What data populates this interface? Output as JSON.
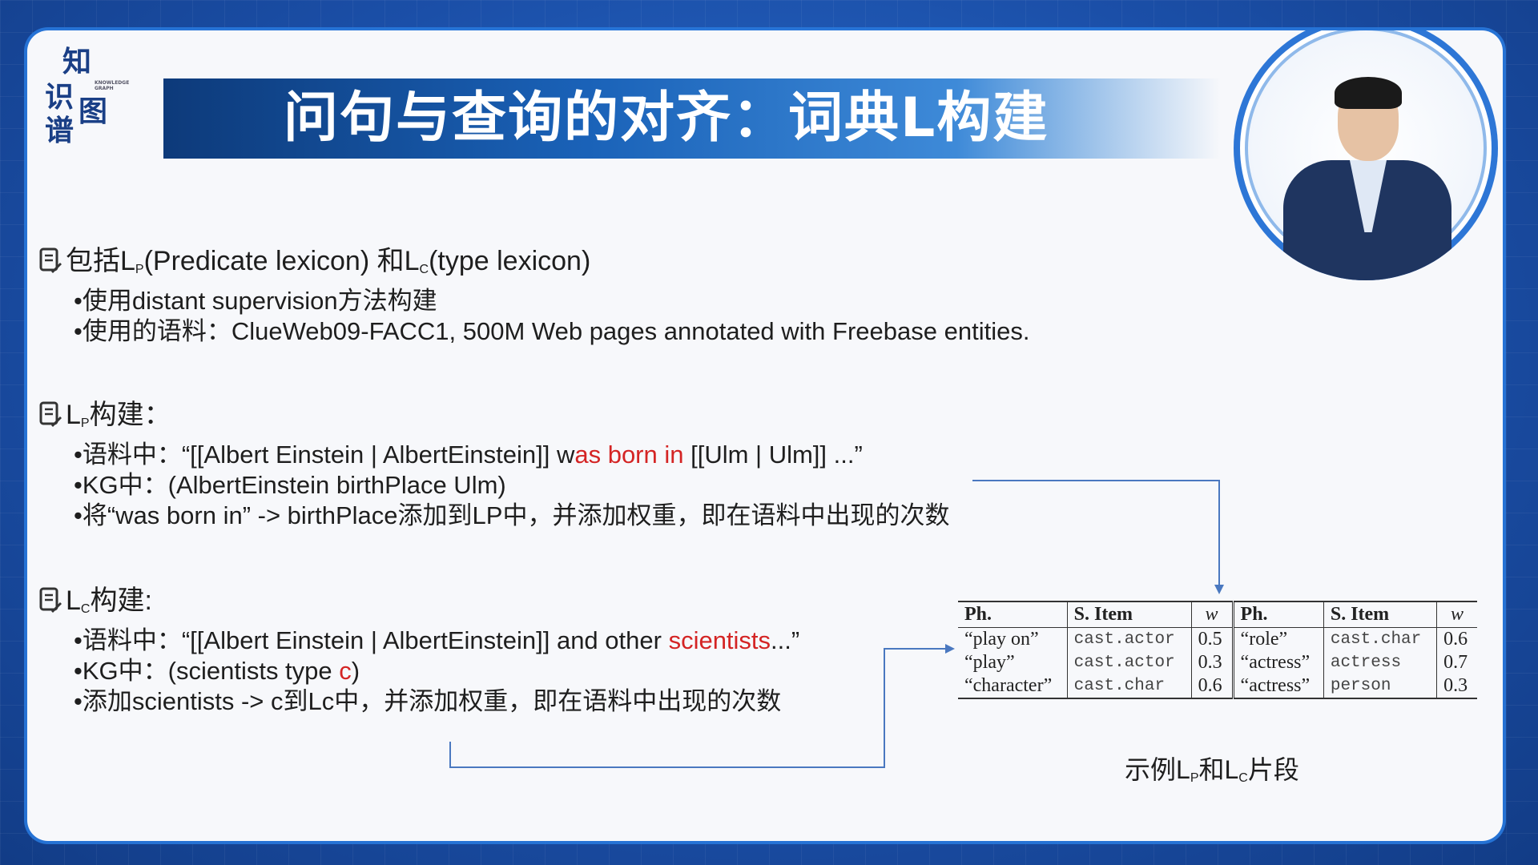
{
  "logo": {
    "chars": [
      "知",
      "识",
      "图",
      "谱"
    ],
    "sub": "KNOWLEDGE GRAPH"
  },
  "title": "问句与查询的对齐：词典L构建",
  "section1": {
    "heading_pre": "包括L",
    "heading_sub1": "P",
    "heading_mid": "(Predicate lexicon) 和L",
    "heading_sub2": "C",
    "heading_post": "(type lexicon)",
    "bullets": [
      "•使用distant supervision方法构建",
      "•使用的语料：ClueWeb09-FACC1, 500M Web pages annotated with Freebase entities."
    ]
  },
  "section2": {
    "heading_pre": "L",
    "heading_sub": "P",
    "heading_post": "构建：",
    "b1_pre": "•语料中：“[[Albert Einstein | AlbertEinstein]] w",
    "b1_red": "as born in",
    "b1_post": " [[Ulm | Ulm]] ...”",
    "b2": "•KG中：(AlbertEinstein birthPlace Ulm)",
    "b3": "•将“was born in” -> birthPlace添加到LP中，并添加权重，即在语料中出现的次数"
  },
  "section3": {
    "heading_pre": "L",
    "heading_sub": "C",
    "heading_post": "构建:",
    "b1_pre": "•语料中：“[[Albert Einstein | AlbertEinstein]] and other ",
    "b1_red": "scientists",
    "b1_post": "...”",
    "b2_pre": "•KG中：(scientists type ",
    "b2_red": "c",
    "b2_post": ")",
    "b3": "•添加scientists -> c到Lc中，并添加权重，即在语料中出现的次数"
  },
  "table": {
    "headers": [
      "Ph.",
      "S. Item",
      "w",
      "Ph.",
      "S. Item",
      "w"
    ],
    "rows": [
      [
        "“play on”",
        "cast.actor",
        "0.5",
        "“role”",
        "cast.char",
        "0.6"
      ],
      [
        "“play”",
        "cast.actor",
        "0.3",
        "“actress”",
        "actress",
        "0.7"
      ],
      [
        "“character”",
        "cast.char",
        "0.6",
        "“actress”",
        "person",
        "0.3"
      ]
    ]
  },
  "caption": {
    "pre": "示例L",
    "sub1": "P",
    "mid": "和L",
    "sub2": "C",
    "post": "片段"
  },
  "colors": {
    "accent": "#2d76d6",
    "highlight": "#d42424",
    "title_bar": "#1a62b8"
  }
}
